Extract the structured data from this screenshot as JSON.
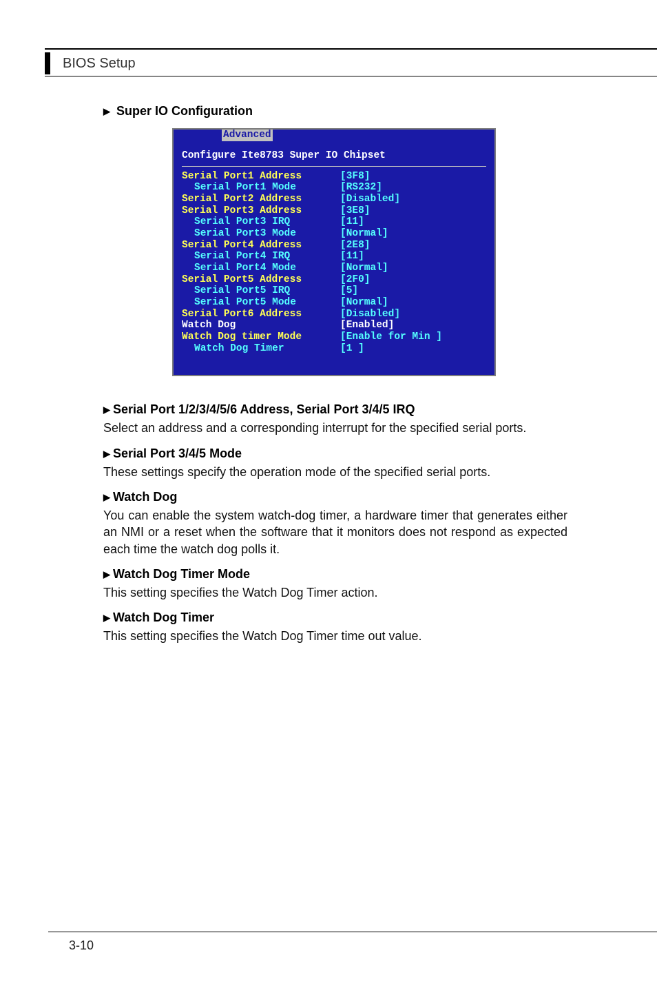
{
  "header": {
    "title": "BIOS Setup"
  },
  "section": {
    "title": "Super IO Configuration"
  },
  "bios": {
    "tab": "Advanced",
    "heading": "Configure Ite8783 Super IO Chipset",
    "rows": [
      {
        "label": "Serial Port1 Address",
        "value": "[3F8]",
        "labelColor": "yellow",
        "valColor": "cyan",
        "indent": false
      },
      {
        "label": "Serial Port1 Mode",
        "value": "[RS232]",
        "labelColor": "cyan",
        "valColor": "cyan",
        "indent": true
      },
      {
        "label": "Serial Port2 Address",
        "value": "[Disabled]",
        "labelColor": "yellow",
        "valColor": "cyan",
        "indent": false
      },
      {
        "label": "Serial Port3 Address",
        "value": "[3E8]",
        "labelColor": "yellow",
        "valColor": "cyan",
        "indent": false
      },
      {
        "label": "Serial Port3 IRQ",
        "value": "[11]",
        "labelColor": "cyan",
        "valColor": "cyan",
        "indent": true
      },
      {
        "label": "Serial Port3 Mode",
        "value": "[Normal]",
        "labelColor": "cyan",
        "valColor": "cyan",
        "indent": true
      },
      {
        "label": "Serial Port4 Address",
        "value": "[2E8]",
        "labelColor": "yellow",
        "valColor": "cyan",
        "indent": false
      },
      {
        "label": "Serial Port4 IRQ",
        "value": "[11]",
        "labelColor": "cyan",
        "valColor": "cyan",
        "indent": true
      },
      {
        "label": "Serial Port4 Mode",
        "value": "[Normal]",
        "labelColor": "cyan",
        "valColor": "cyan",
        "indent": true
      },
      {
        "label": "Serial Port5 Address",
        "value": "[2F0]",
        "labelColor": "yellow",
        "valColor": "cyan",
        "indent": false
      },
      {
        "label": "Serial Port5 IRQ",
        "value": "[5]",
        "labelColor": "cyan",
        "valColor": "cyan",
        "indent": true
      },
      {
        "label": "Serial Port5 Mode",
        "value": "[Normal]",
        "labelColor": "cyan",
        "valColor": "cyan",
        "indent": true
      },
      {
        "label": "Serial Port6 Address",
        "value": "[Disabled]",
        "labelColor": "yellow",
        "valColor": "cyan",
        "indent": false
      },
      {
        "label": "Watch Dog",
        "value": "[Enabled]",
        "labelColor": "white",
        "valColor": "white",
        "indent": false
      },
      {
        "label": "Watch Dog timer Mode",
        "value": "[Enable for Min  ]",
        "labelColor": "yellow",
        "valColor": "cyan",
        "indent": false
      },
      {
        "label": "Watch Dog Timer",
        "value": "[1  ]",
        "labelColor": "cyan",
        "valColor": "cyan",
        "indent": true
      }
    ]
  },
  "doc": {
    "items": [
      {
        "title": "Serial Port 1/2/3/4/5/6 Address, Serial Port 3/4/5 IRQ",
        "body": "Select an address and a corresponding interrupt for the specified serial ports."
      },
      {
        "title": "Serial Port 3/4/5 Mode",
        "body": "These settings specify the operation mode of the specified serial ports."
      },
      {
        "title": "Watch Dog",
        "body": "You can enable the system watch-dog timer, a hardware timer that generates either an NMI or a reset when the software that it monitors does not respond as expected each time the watch dog polls it."
      },
      {
        "title": "Watch Dog Timer Mode",
        "body": "This setting specifies the Watch Dog Timer action."
      },
      {
        "title": "Watch Dog Timer",
        "body": "This setting specifies the Watch Dog Timer time out value."
      }
    ]
  },
  "footer": {
    "page": "3-10"
  }
}
